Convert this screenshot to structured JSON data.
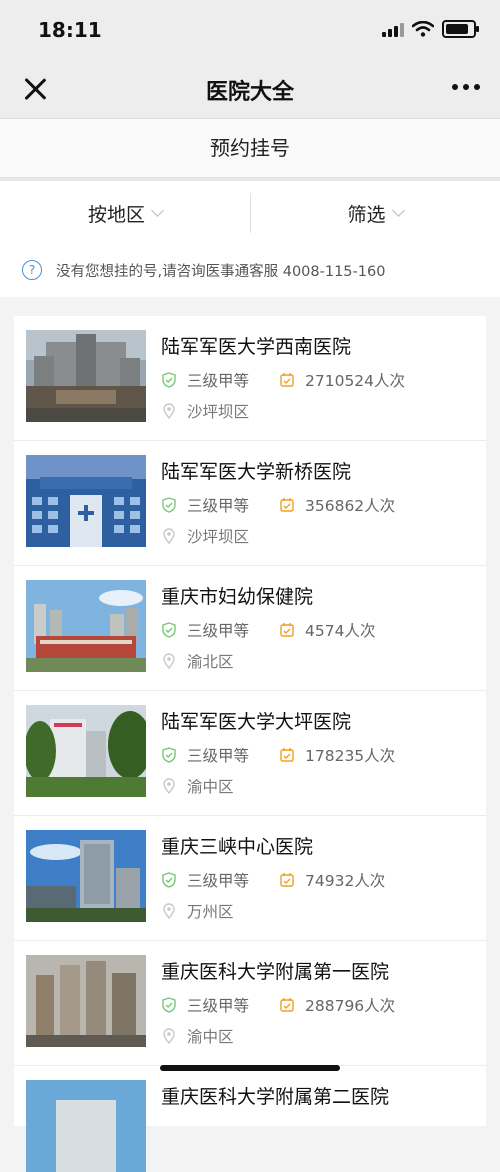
{
  "status": {
    "time": "18:11"
  },
  "nav": {
    "title": "医院大全"
  },
  "section": {
    "title": "预约挂号"
  },
  "filters": [
    {
      "label": "按地区"
    },
    {
      "label": "筛选"
    }
  ],
  "notice": {
    "text": "没有您想挂的号,请咨询医事通客服 4008-115-160"
  },
  "hospitals": [
    {
      "name": "陆军军医大学西南医院",
      "grade": "三级甲等",
      "visits": "2710524人次",
      "district": "沙坪坝区"
    },
    {
      "name": "陆军军医大学新桥医院",
      "grade": "三级甲等",
      "visits": "356862人次",
      "district": "沙坪坝区"
    },
    {
      "name": "重庆市妇幼保健院",
      "grade": "三级甲等",
      "visits": "4574人次",
      "district": "渝北区"
    },
    {
      "name": "陆军军医大学大坪医院",
      "grade": "三级甲等",
      "visits": "178235人次",
      "district": "渝中区"
    },
    {
      "name": "重庆三峡中心医院",
      "grade": "三级甲等",
      "visits": "74932人次",
      "district": "万州区"
    },
    {
      "name": "重庆医科大学附属第一医院",
      "grade": "三级甲等",
      "visits": "288796人次",
      "district": "渝中区"
    },
    {
      "name": "重庆医科大学附属第二医院",
      "grade": "",
      "visits": "",
      "district": ""
    }
  ],
  "colors": {
    "shield": "#78c878",
    "visit": "#f0a020",
    "location": "#c8c8c8",
    "help": "#4a90d9"
  }
}
